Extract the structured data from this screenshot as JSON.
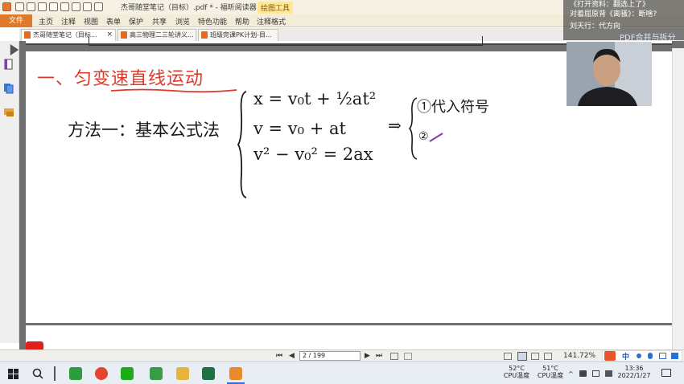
{
  "window": {
    "doc_title": "杰哥随堂笔记（目标）.pdf * - 福昕阅读器",
    "tool_tab": "绘图工具"
  },
  "menu": {
    "file": "文件",
    "items": [
      "主页",
      "注释",
      "视图",
      "表单",
      "保护",
      "共享",
      "浏览",
      "特色功能",
      "帮助",
      "注释格式"
    ]
  },
  "tabs": [
    {
      "label": "杰哥随堂笔记（目标...",
      "close": "×"
    },
    {
      "label": "高三物理二三轮讲义..."
    },
    {
      "label": "班级完课PK计划-目..."
    }
  ],
  "notes": {
    "heading": "一、匀变速直线运动",
    "method": "方法一：基本公式法",
    "eq1": "x = v₀t + ½at²",
    "eq2": "v = v₀ + at",
    "eq3": "v² − v₀² = 2ax",
    "arrow": "⇒",
    "result1": "①代入符号",
    "result2": "②"
  },
  "status": {
    "page_input": "2 / 199",
    "zoom": "141.72%",
    "nav_first": "⏮",
    "nav_prev": "◀",
    "nav_next": "▶",
    "nav_last": "⏭"
  },
  "overlay": {
    "chat": [
      "《打开资料：翻选上了》",
      "对着屈原背《离骚》：断啥?",
      "刘天行：代方向"
    ],
    "pdf_merge": "PDF合并与拆分"
  },
  "taskbar": {
    "temp1_value": "52°C",
    "temp1_label": "CPU温度",
    "temp2_value": "51°C",
    "temp2_label": "CPU温度",
    "time": "13:36",
    "date": "2022/1/27",
    "ime_lang": "中"
  },
  "colors": {
    "accent_orange": "#e07a2a",
    "heading_red": "#e0392b",
    "ink_dark": "#1a1a1a"
  }
}
